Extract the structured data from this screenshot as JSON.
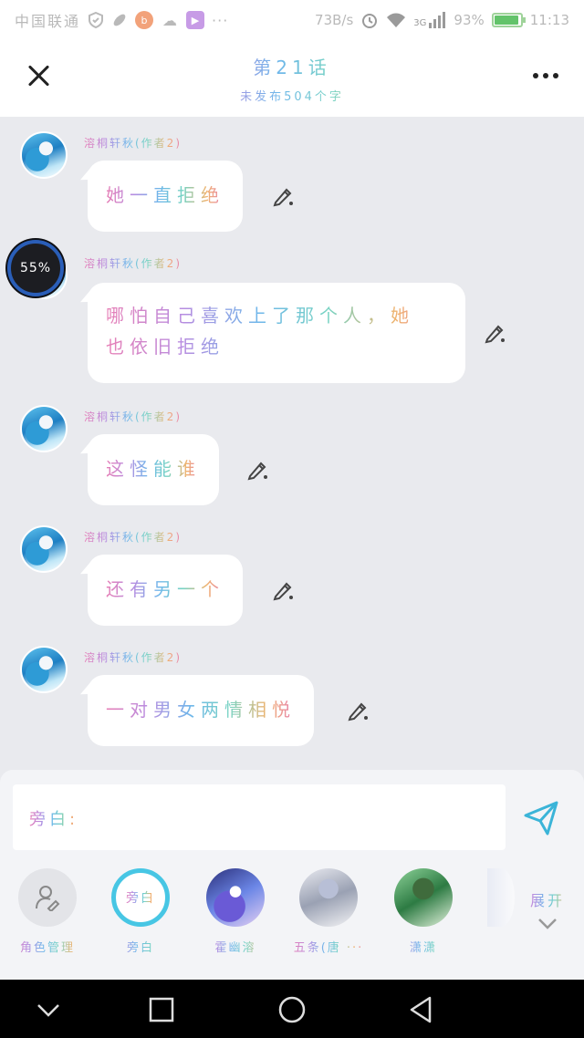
{
  "status_bar": {
    "carrier": "中国联通",
    "net_speed": "73B/s",
    "network": "3G",
    "battery": "93%",
    "battery_level": 0.93,
    "time": "11:13"
  },
  "header": {
    "title": "第21话",
    "subtitle": "未发布504个字"
  },
  "messages": [
    {
      "author": "溶桐轩秋(作者2)",
      "text": "她一直拒绝"
    },
    {
      "author": "溶桐轩秋(作者2)",
      "text_line1": "哪怕自己喜欢上了那个人，她",
      "text_line2": "也依旧拒绝"
    },
    {
      "author": "溶桐轩秋(作者2)",
      "text": "这怪能谁"
    },
    {
      "author": "溶桐轩秋(作者2)",
      "text": "还有另一个"
    },
    {
      "author": "溶桐轩秋(作者2)",
      "text": "一对男女两情相悦"
    }
  ],
  "progress_overlay": {
    "label": "55%",
    "value": 0.55
  },
  "composer": {
    "input_value": "旁白:"
  },
  "roles": [
    {
      "label": "角色管理",
      "icon": "person-edit-icon"
    },
    {
      "label": "旁白",
      "circle_text": "旁白"
    },
    {
      "label": "霍幽溶"
    },
    {
      "label": "五条(唐 ···"
    },
    {
      "label": "潇潇"
    }
  ],
  "expand_label": "展开",
  "colors": {
    "accent": "#47c6e4",
    "send": "#3bb4d8",
    "background": "#e9eaee"
  }
}
